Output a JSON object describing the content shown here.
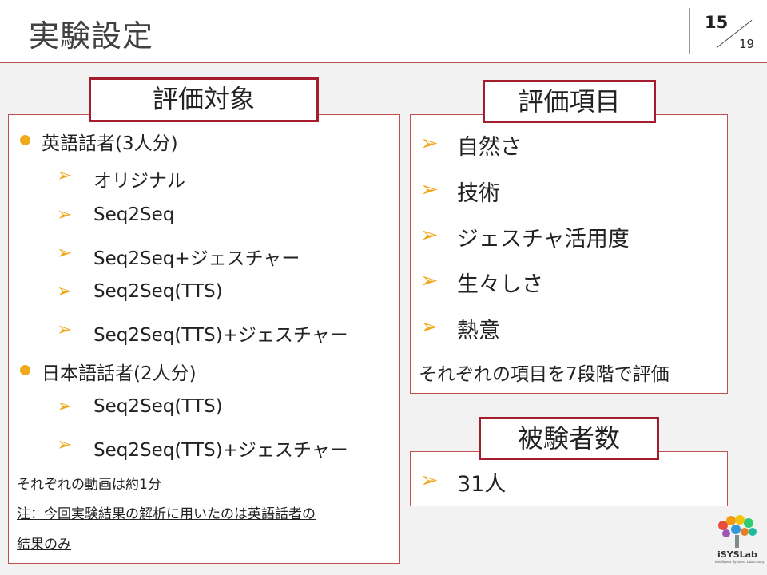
{
  "slide": {
    "title": "実験設定",
    "page_current": "15",
    "page_total": "19"
  },
  "targets": {
    "label": "評価対象",
    "groups": [
      {
        "header": "英語話者(3人分)",
        "items": [
          "オリジナル",
          "Seq2Seq",
          "Seq2Seq+ジェスチャー",
          "Seq2Seq(TTS)",
          "Seq2Seq(TTS)+ジェスチャー"
        ]
      },
      {
        "header": "日本語話者(2人分)",
        "items": [
          "Seq2Seq(TTS)",
          "Seq2Seq(TTS)+ジェスチャー"
        ]
      }
    ],
    "note1": "それぞれの動画は約1分",
    "note2_line1": "注：今回実験結果の解析に用いたのは英語話者の",
    "note2_line2": "結果のみ"
  },
  "criteria": {
    "label": "評価項目",
    "items": [
      "自然さ",
      "技術",
      "ジェスチャ活用度",
      "生々しさ",
      "熱意"
    ],
    "note": "それぞれの項目を7段階で評価"
  },
  "subjects": {
    "label": "被験者数",
    "items": [
      "31人"
    ]
  },
  "logo": {
    "text": "iSYSLab",
    "subtext": "Intelligent Systems Laboratory"
  },
  "colors": {
    "accent_border": "#a51d2d",
    "bullet": "#f0a81d"
  },
  "icons": {
    "arrow_bullet": "➢"
  }
}
